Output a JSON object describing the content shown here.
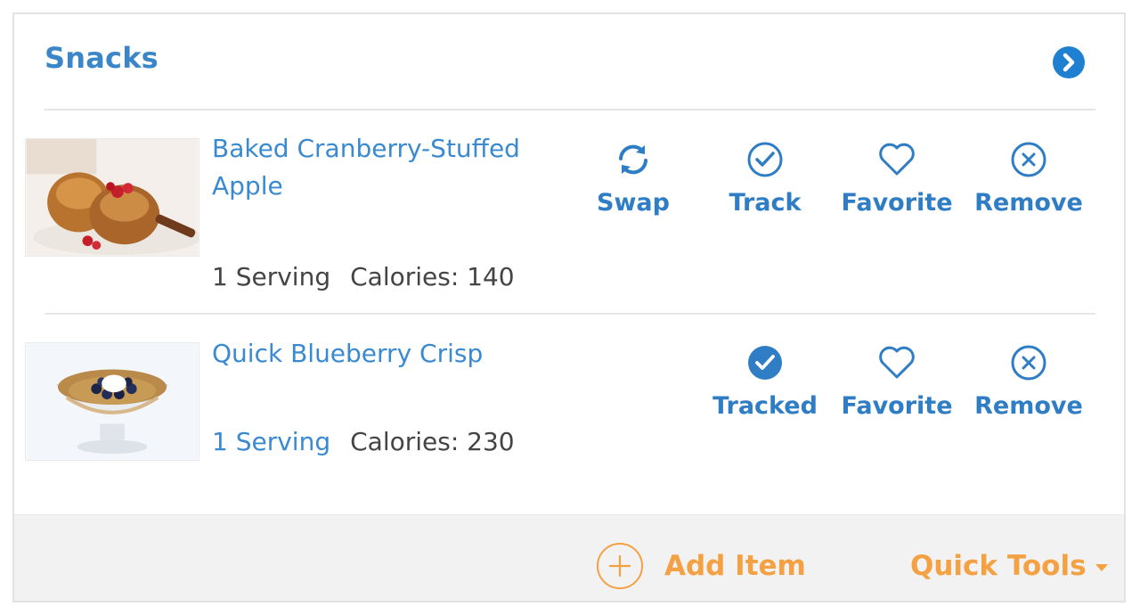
{
  "section": {
    "title": "Snacks",
    "accent_color": "#3a86c8",
    "expand_icon": "chevron-right-circle-icon"
  },
  "items": [
    {
      "name": "Baked Cranberry-Stuffed Apple",
      "serving": "1 Serving",
      "calories": "Calories: 140",
      "actions": {
        "swap": "Swap",
        "track": "Track",
        "favorite": "Favorite",
        "remove": "Remove"
      }
    },
    {
      "name": "Quick Blueberry Crisp",
      "serving": "1 Serving",
      "calories": "Calories: 230",
      "actions": {
        "tracked": "Tracked",
        "favorite": "Favorite",
        "remove": "Remove"
      }
    }
  ],
  "footer": {
    "add_item": "Add Item",
    "quick_tools": "Quick Tools",
    "accent_color": "#f3a143"
  }
}
